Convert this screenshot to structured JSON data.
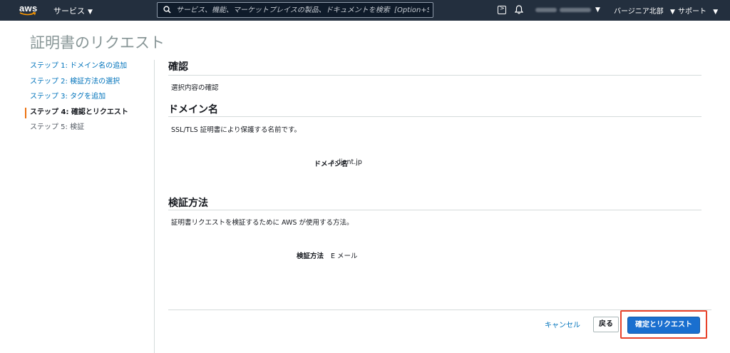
{
  "topnav": {
    "logo_text": "aws",
    "services_label": "サービス",
    "search_placeholder": "サービス、機能、マーケットプレイスの製品、ドキュメントを検索  [Option+S]",
    "region_label": "バージニア北部",
    "support_label": "サポート"
  },
  "page": {
    "title": "証明書のリクエスト"
  },
  "sidebar": {
    "steps": [
      {
        "label": "ステップ 1: ドメイン名の追加",
        "state": "link"
      },
      {
        "label": "ステップ 2: 検証方法の選択",
        "state": "link"
      },
      {
        "label": "ステップ 3: タグを追加",
        "state": "link"
      },
      {
        "label": "ステップ 4: 確認とリクエスト",
        "state": "active"
      },
      {
        "label": "ステップ 5: 検証",
        "state": "inactive"
      }
    ]
  },
  "main": {
    "review": {
      "heading": "確認",
      "description": "選択内容の確認"
    },
    "domain": {
      "heading": "ドメイン名",
      "description": "SSL/TLS 証明書により保護する名前です。",
      "key": "ドメイン名",
      "value": "s.djent.jp"
    },
    "validation": {
      "heading": "検証方法",
      "description": "証明書リクエストを検証するために AWS が使用する方法。",
      "key": "検証方法",
      "value": "E メール"
    }
  },
  "footer": {
    "cancel_label": "キャンセル",
    "back_label": "戻る",
    "confirm_label": "確定とリクエスト"
  },
  "colors": {
    "nav_bg": "#232f3e",
    "link": "#0073bb",
    "active_marker": "#ec7211",
    "primary_button": "#1a6fcf",
    "highlight_box": "#e8422a"
  }
}
